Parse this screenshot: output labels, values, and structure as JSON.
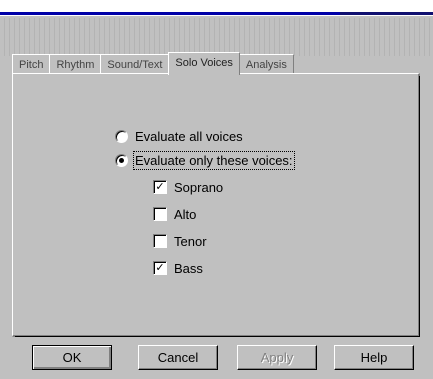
{
  "tabs": [
    "Pitch",
    "Rhythm",
    "Sound/Text",
    "Solo Voices",
    "Analysis"
  ],
  "options": {
    "evaluate_all": "Evaluate all voices",
    "evaluate_only": "Evaluate only these voices:",
    "selected": "evaluate_only"
  },
  "voices": [
    {
      "label": "Soprano",
      "checked": true
    },
    {
      "label": "Alto",
      "checked": false
    },
    {
      "label": "Tenor",
      "checked": false
    },
    {
      "label": "Bass",
      "checked": true
    }
  ],
  "buttons": {
    "ok": "OK",
    "cancel": "Cancel",
    "apply": "Apply",
    "help": "Help"
  }
}
